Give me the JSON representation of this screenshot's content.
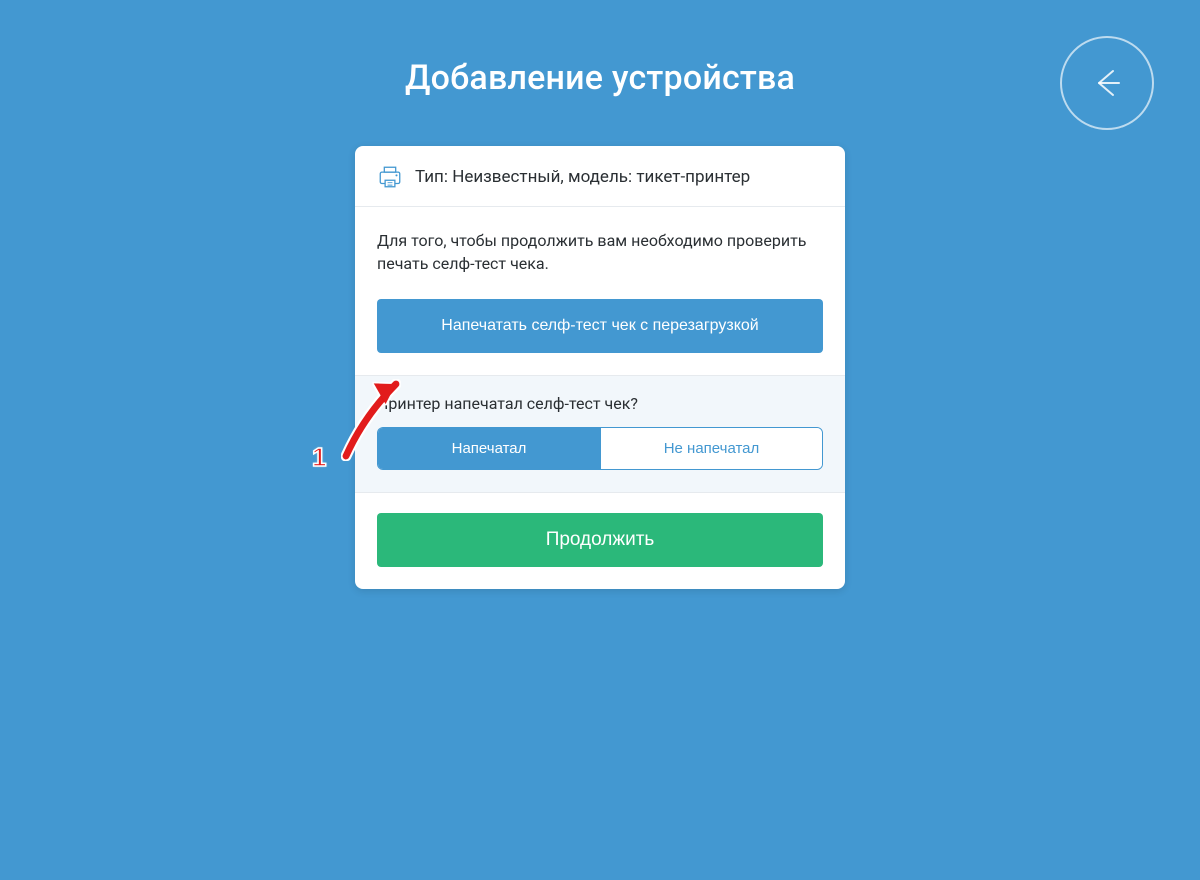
{
  "header": {
    "title": "Добавление устройства"
  },
  "card": {
    "device_info": "Тип: Неизвестный, модель: тикет-принтер",
    "instruction": "Для того, чтобы продолжить вам необходимо проверить печать селф-тест чека.",
    "print_button_label": "Напечатать селф-тест чек с перезагрузкой",
    "question": "Принтер напечатал селф-тест чек?",
    "option_yes": "Напечатал",
    "option_no": "Не напечатал",
    "continue_label": "Продолжить"
  },
  "annotation": {
    "step_number": "1"
  },
  "colors": {
    "bg": "#4398d1",
    "accent": "#4398d1",
    "success": "#2bb87a",
    "alt_panel": "#f2f7fb",
    "annotation_red": "#e21a1a"
  }
}
